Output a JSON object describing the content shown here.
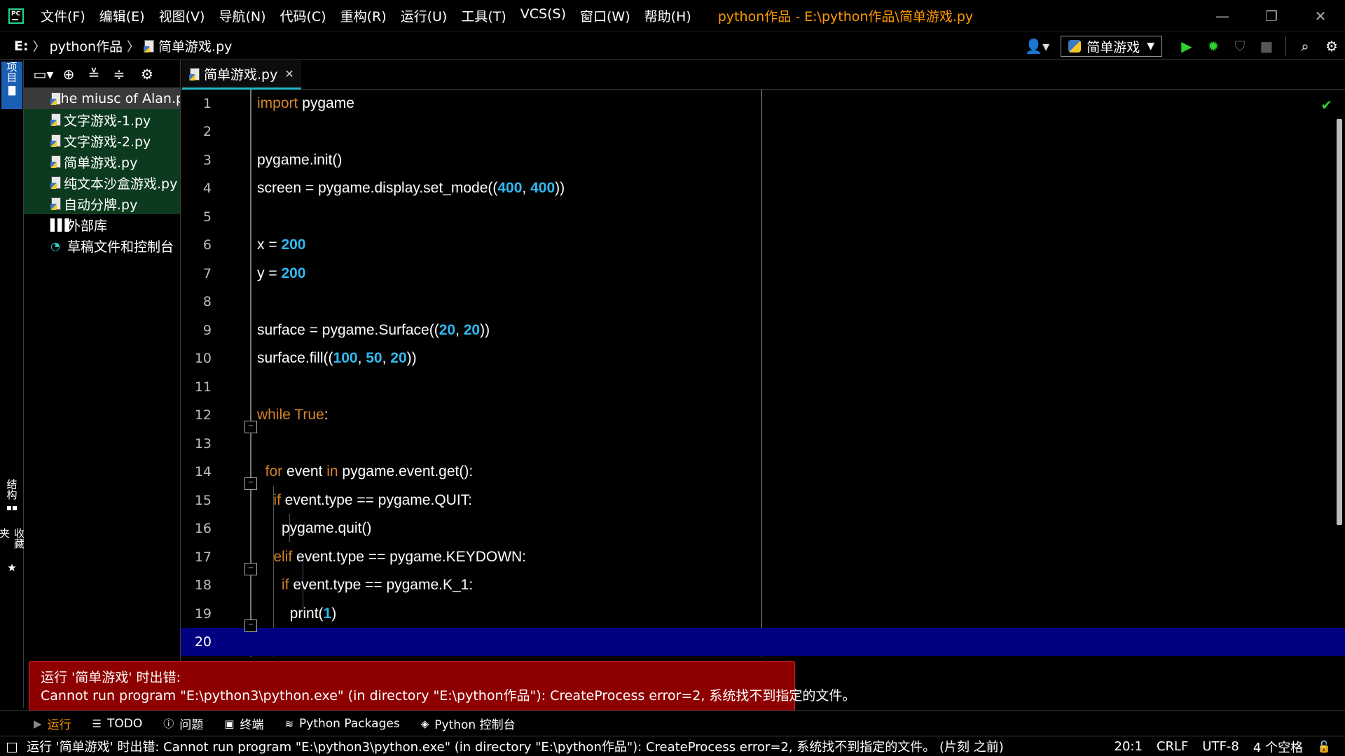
{
  "titlebar": {
    "logo_text": "PC",
    "menu": [
      "文件(F)",
      "编辑(E)",
      "视图(V)",
      "导航(N)",
      "代码(C)",
      "重构(R)",
      "运行(U)",
      "工具(T)",
      "VCS(S)",
      "窗口(W)",
      "帮助(H)"
    ],
    "window_title": "python作品 - E:\\python作品\\简单游戏.py",
    "controls": {
      "minimize": "—",
      "restore": "❐",
      "close": "✕"
    }
  },
  "navbar": {
    "drive": "E:",
    "folder": "python作品",
    "file": "简单游戏.py",
    "run_config": "简单游戏"
  },
  "left_strip": {
    "project": "项目",
    "structure": "结构",
    "favorites": "收藏夹"
  },
  "project_tree": {
    "items": [
      {
        "label": "The miusc of Alan.py",
        "type": "py"
      },
      {
        "label": "文字游戏-1.py",
        "type": "py"
      },
      {
        "label": "文字游戏-2.py",
        "type": "py"
      },
      {
        "label": "简单游戏.py",
        "type": "py"
      },
      {
        "label": "纯文本沙盒游戏.py",
        "type": "py"
      },
      {
        "label": "自动分牌.py",
        "type": "py"
      }
    ],
    "external_libraries": "外部库",
    "scratches": "草稿文件和控制台"
  },
  "editor": {
    "tab_label": "简单游戏.py",
    "current_line": 20,
    "line_numbers": [
      "1",
      "2",
      "3",
      "4",
      "5",
      "6",
      "7",
      "8",
      "9",
      "10",
      "11",
      "12",
      "13",
      "14",
      "15",
      "16",
      "17",
      "18",
      "19",
      "20"
    ]
  },
  "balloon": {
    "title": "运行 '简单游戏' 时出错:",
    "message": "Cannot run program \"E:\\python3\\python.exe\" (in directory \"E:\\python作品\"): CreateProcess error=2, 系统找不到指定的文件。"
  },
  "toolwindows": {
    "run": "运行",
    "todo": "TODO",
    "problems": "问题",
    "terminal": "终端",
    "packages": "Python Packages",
    "console": "Python 控制台"
  },
  "statusbar": {
    "message": "运行 '简单游戏' 时出错: Cannot run program \"E:\\python3\\python.exe\" (in directory \"E:\\python作品\"): CreateProcess error=2, 系统找不到指定的文件。 (片刻 之前)",
    "position": "20:1",
    "line_sep": "CRLF",
    "encoding": "UTF-8",
    "indent": "4 个空格"
  },
  "colors": {
    "keyword": "#d4832a",
    "number": "#30b9f0",
    "current_line": "#000080",
    "error_balloon": "#8e0000",
    "title_accent": "#ff9900"
  }
}
